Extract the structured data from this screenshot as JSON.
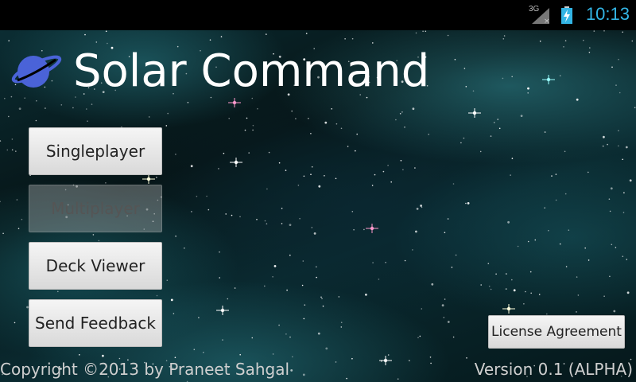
{
  "status_bar": {
    "network_label": "3G",
    "time": "10:13",
    "network_icon": "signal-no-data-icon",
    "battery_icon": "battery-charging-icon",
    "time_color": "#33b5e5"
  },
  "app": {
    "title": "Solar Command",
    "logo_icon": "planet-ring-icon",
    "logo_color": "#4a63d8"
  },
  "menu": {
    "singleplayer": "Singleplayer",
    "multiplayer": "Multiplayer",
    "multiplayer_enabled": false,
    "deck_viewer": "Deck Viewer",
    "send_feedback": "Send Feedback"
  },
  "footer": {
    "license": "License Agreement",
    "copyright": "Copyright ©2013 by Praneet Sahgal",
    "version": "Version 0.1 (ALPHA)"
  }
}
